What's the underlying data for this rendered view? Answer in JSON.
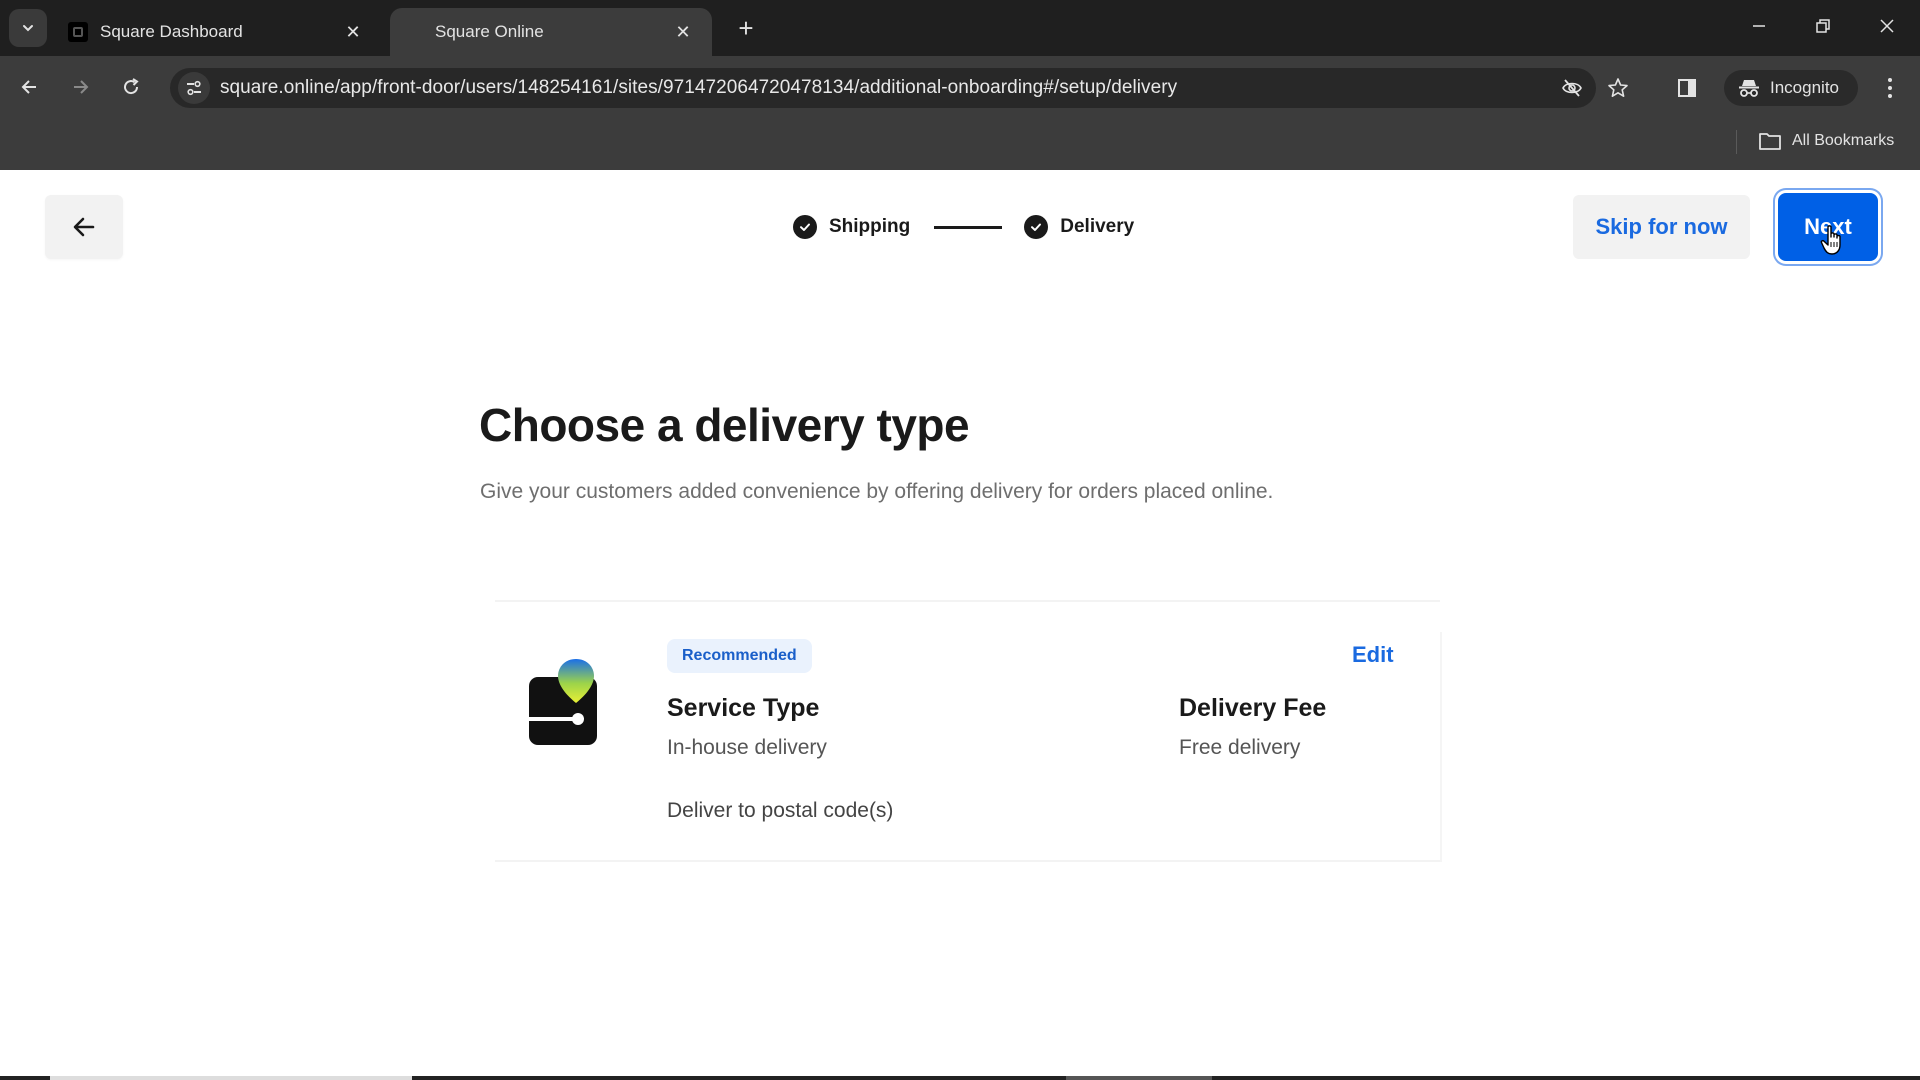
{
  "browser": {
    "tabs": [
      {
        "title": "Square Dashboard",
        "active": false,
        "favicon": "square-logo-icon"
      },
      {
        "title": "Square Online",
        "active": true
      }
    ],
    "tab_close_glyph": "✕",
    "new_tab_glyph": "+",
    "url": "square.online/app/front-door/users/148254161/sites/971472064720478134/additional-onboarding#/setup/delivery",
    "incognito_label": "Incognito",
    "bookmarks_label": "All Bookmarks",
    "window_controls": {
      "minimize": "—",
      "restore": "❐",
      "close": "✕"
    }
  },
  "header": {
    "back_icon": "arrow-left-icon",
    "steps": [
      {
        "label": "Shipping",
        "status": "complete"
      },
      {
        "label": "Delivery",
        "status": "complete"
      }
    ],
    "skip_label": "Skip for now",
    "next_label": "Next"
  },
  "main": {
    "title": "Choose a delivery type",
    "subtitle": "Give your customers added convenience by offering delivery for orders placed online.",
    "delivery_option": {
      "badge": "Recommended",
      "edit_label": "Edit",
      "service_type_label": "Service Type",
      "service_type_value": "In-house delivery",
      "delivery_fee_label": "Delivery Fee",
      "delivery_fee_value": "Free delivery",
      "coverage": "Deliver to postal code(s)"
    }
  },
  "colors": {
    "primary": "#0060e6",
    "link": "#1a6ae0",
    "badge_bg": "#eaf2fd",
    "text": "#1a1a1a"
  }
}
